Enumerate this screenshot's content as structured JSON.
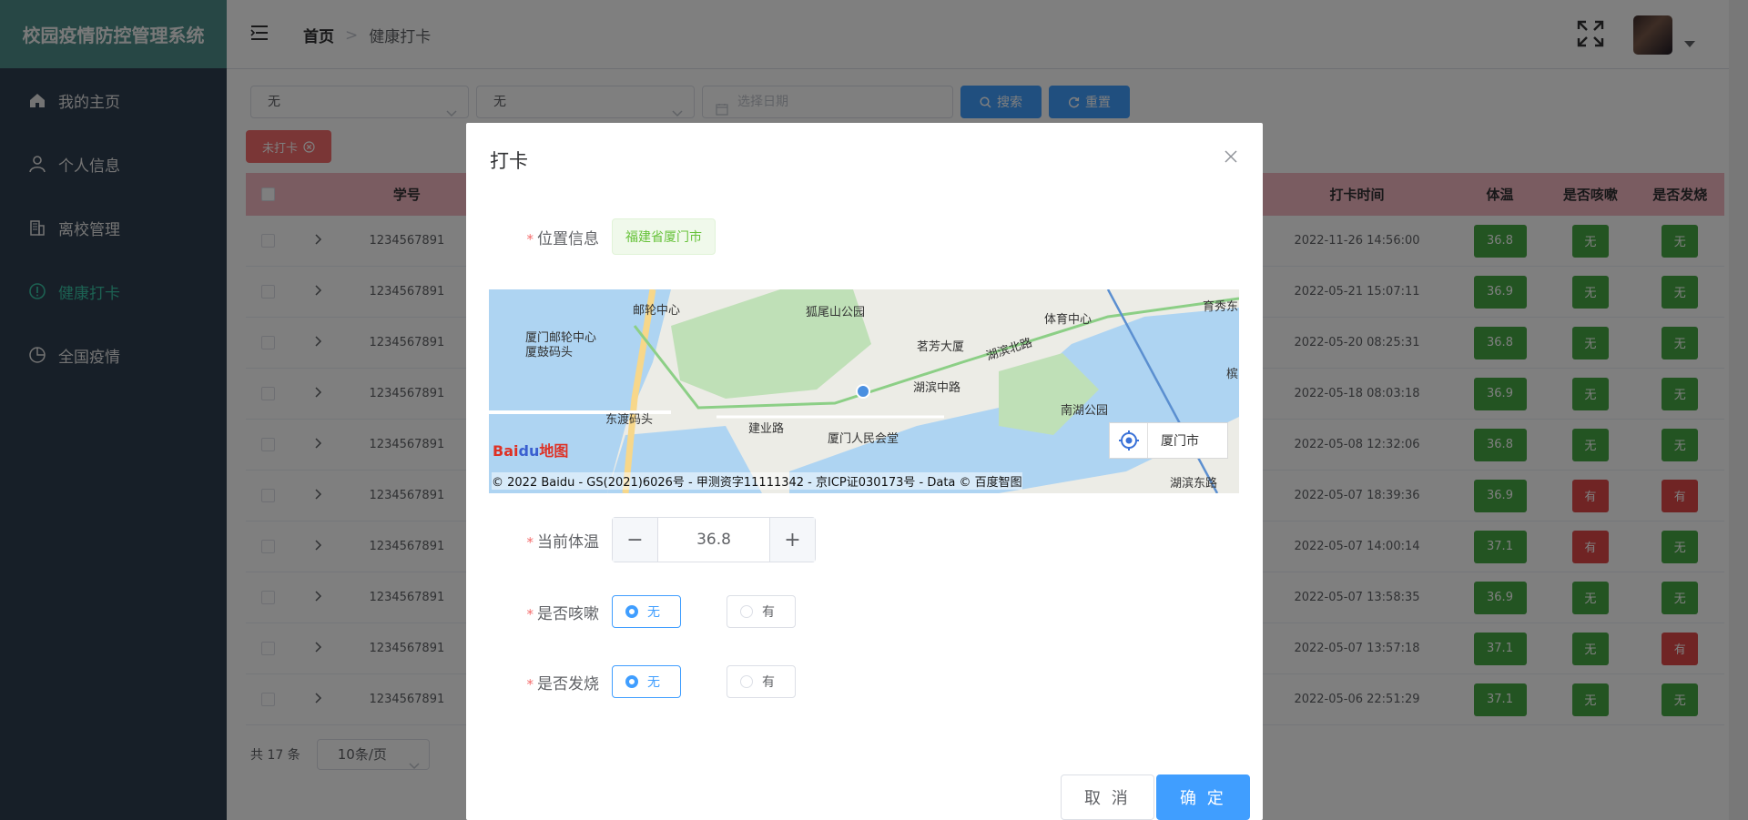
{
  "app": {
    "title": "校园疫情防控管理系统"
  },
  "sidebar": {
    "items": [
      {
        "label": "我的主页",
        "icon": "home-icon"
      },
      {
        "label": "个人信息",
        "icon": "user-icon"
      },
      {
        "label": "离校管理",
        "icon": "building-icon"
      },
      {
        "label": "健康打卡",
        "icon": "alert-circle-icon",
        "active": true
      },
      {
        "label": "全国疫情",
        "icon": "pie-chart-icon"
      }
    ]
  },
  "header": {
    "breadcrumb": [
      "首页",
      "健康打卡"
    ],
    "separator": ">"
  },
  "filters": {
    "select1": "无",
    "select2": "无",
    "date_placeholder": "选择日期",
    "search_label": "搜索",
    "reset_label": "重置"
  },
  "tag_unpunched": "未打卡",
  "table": {
    "headers": {
      "id": "学号",
      "time": "打卡时间",
      "temp": "体温",
      "cough": "是否咳嗽",
      "fever": "是否发烧"
    },
    "rows": [
      {
        "id": "1234567891",
        "time": "2022-11-26 14:56:00",
        "temp": "36.8",
        "cough": "无",
        "fever": "无"
      },
      {
        "id": "1234567891",
        "time": "2022-05-21 15:07:11",
        "temp": "36.9",
        "cough": "无",
        "fever": "无"
      },
      {
        "id": "1234567891",
        "time": "2022-05-20 08:25:31",
        "temp": "36.8",
        "cough": "无",
        "fever": "无"
      },
      {
        "id": "1234567891",
        "time": "2022-05-18 08:03:18",
        "temp": "36.9",
        "cough": "无",
        "fever": "无"
      },
      {
        "id": "1234567891",
        "time": "2022-05-08 12:32:06",
        "temp": "36.8",
        "cough": "无",
        "fever": "无"
      },
      {
        "id": "1234567891",
        "time": "2022-05-07 18:39:36",
        "temp": "36.9",
        "cough": "有",
        "fever": "有"
      },
      {
        "id": "1234567891",
        "time": "2022-05-07 14:00:14",
        "temp": "37.1",
        "cough": "有",
        "fever": "无"
      },
      {
        "id": "1234567891",
        "time": "2022-05-07 13:58:35",
        "temp": "36.9",
        "cough": "无",
        "fever": "无"
      },
      {
        "id": "1234567891",
        "time": "2022-05-07 13:57:18",
        "temp": "37.1",
        "cough": "无",
        "fever": "有"
      },
      {
        "id": "1234567891",
        "time": "2022-05-06 22:51:29",
        "temp": "37.1",
        "cough": "无",
        "fever": "无"
      }
    ]
  },
  "pagination": {
    "total_prefix": "共",
    "total": "17",
    "total_suffix": "条",
    "page_size": "10条/页"
  },
  "dialog": {
    "title": "打卡",
    "location_label": "位置信息",
    "location_value": "福建省厦门市",
    "map": {
      "labels": [
        "邮轮中心",
        "狐尾山公园",
        "厦门邮轮中心",
        "厦鼓码头",
        "东渡码头",
        "建业路",
        "厦门人民会堂",
        "茗芳大厦",
        "湖滨中路",
        "湖滨北路",
        "体育中心",
        "育秀东",
        "南湖公园",
        "湖滨东路",
        "槟"
      ],
      "copyright": "© 2022 Baidu - GS(2021)6026号 - 甲测资字11111342 - 京ICP证030173号 - Data © 百度智图",
      "city": "厦门市",
      "logo_a": "Bai",
      "logo_b": "du",
      "logo_c": "地图"
    },
    "temp_label": "当前体温",
    "temp_value": "36.8",
    "minus": "−",
    "plus": "+",
    "cough_label": "是否咳嗽",
    "fever_label": "是否发烧",
    "option_no": "无",
    "option_yes": "有",
    "cancel_label": "取 消",
    "confirm_label": "确 定",
    "required_mark": "*"
  },
  "colors": {
    "sidebar_bg": "#2f3e50",
    "brand_bg": "#4f8f8a",
    "active": "#38c3a5",
    "primary": "#409eff",
    "green": "#46a844",
    "red": "#e04848",
    "header_row": "#f5b8c3"
  }
}
